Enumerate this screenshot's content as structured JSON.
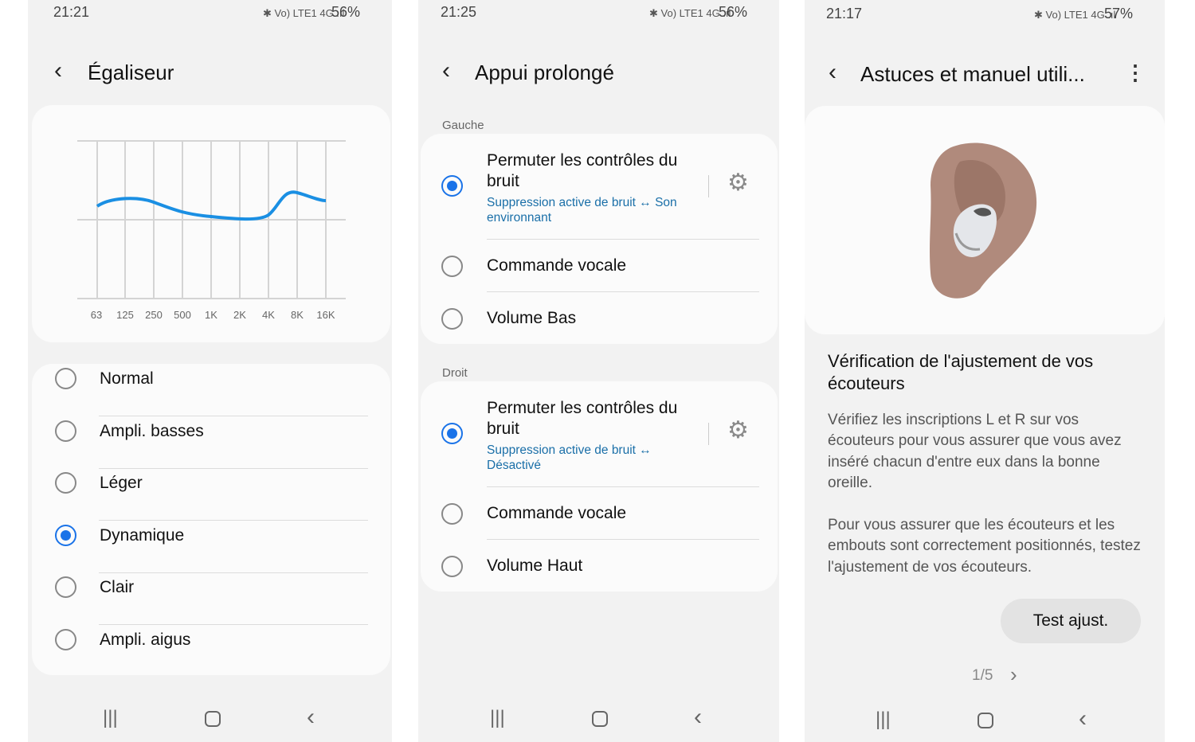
{
  "screens": [
    {
      "status": {
        "time": "21:21",
        "battery": "56%"
      },
      "title": "Égaliseur",
      "eq_ticks": [
        "63",
        "125",
        "250",
        "500",
        "1K",
        "2K",
        "4K",
        "8K",
        "16K"
      ],
      "presets": [
        {
          "label": "Normal",
          "selected": false
        },
        {
          "label": "Ampli. basses",
          "selected": false
        },
        {
          "label": "Léger",
          "selected": false
        },
        {
          "label": "Dynamique",
          "selected": true
        },
        {
          "label": "Clair",
          "selected": false
        },
        {
          "label": "Ampli. aigus",
          "selected": false
        }
      ]
    },
    {
      "status": {
        "time": "21:25",
        "battery": "56%"
      },
      "title": "Appui prolongé",
      "left": {
        "section": "Gauche",
        "option1": "Permuter les contrôles du",
        "option1b": "bruit",
        "option1_sub": "Suppression active de bruit ↔ Son environnant",
        "option2": "Commande vocale",
        "option3": "Volume Bas"
      },
      "right": {
        "section": "Droit",
        "option1": "Permuter les contrôles du",
        "option1b": "bruit",
        "option1_sub": "Suppression active de bruit ↔ Désactivé",
        "option2": "Commande vocale",
        "option3": "Volume Haut"
      }
    },
    {
      "status": {
        "time": "21:17",
        "battery": "57%"
      },
      "title": "Astuces et manuel utili...",
      "heading": "Vérification de l'ajustement de vos écouteurs",
      "para1": "Vérifiez les inscriptions L et R sur vos écouteurs pour vous assurer que vous avez inséré chacun d'entre eux dans la bonne oreille.",
      "para2": "Pour vous assurer que les écouteurs et les embouts sont correctement positionnés, testez l'ajustement de vos écouteurs.",
      "button": "Test ajust.",
      "pager": "1/5"
    }
  ],
  "status_icons": "✱ Vo) LTE1 4G .ıl",
  "accent": "#1a73e8"
}
